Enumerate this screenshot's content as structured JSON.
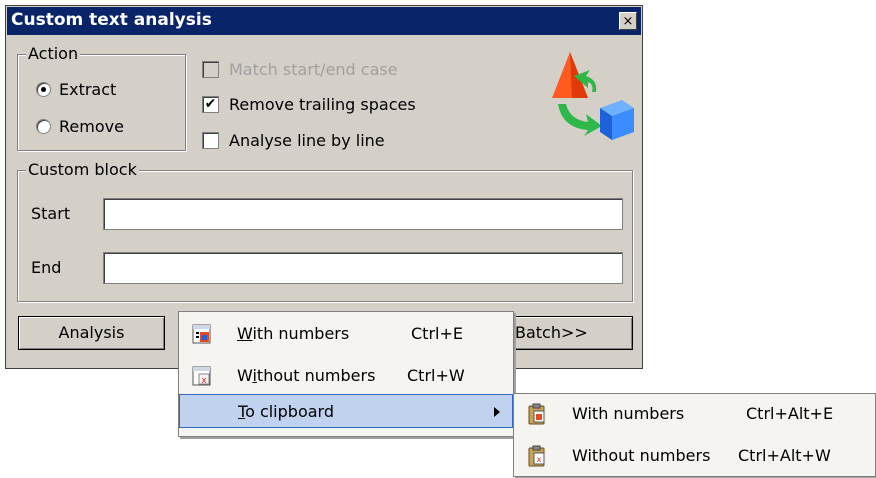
{
  "window": {
    "title": "Custom text analysis",
    "close_glyph": "×"
  },
  "action": {
    "legend": "Action",
    "options": [
      {
        "label": "Extract",
        "selected": true
      },
      {
        "label": "Remove",
        "selected": false
      }
    ]
  },
  "options": [
    {
      "label": "Match start/end case",
      "checked": false,
      "disabled": true
    },
    {
      "label": "Remove trailing spaces",
      "checked": true,
      "disabled": false
    },
    {
      "label": "Analyse line by line",
      "checked": false,
      "disabled": false
    }
  ],
  "custom_block": {
    "legend": "Custom block",
    "start_label": "Start",
    "start_value": "",
    "end_label": "End",
    "end_value": ""
  },
  "buttons": {
    "analysis": "Analysis",
    "batch": "Batch>>"
  },
  "menu": {
    "items": [
      {
        "prefix": "",
        "underline": "W",
        "rest": "ith numbers",
        "shortcut": "Ctrl+E",
        "icon": "table-numbers-icon"
      },
      {
        "prefix": "W",
        "underline": "i",
        "rest": "thout numbers",
        "shortcut": "Ctrl+W",
        "icon": "table-no-numbers-icon"
      },
      {
        "prefix": "",
        "underline": "T",
        "rest": "o clipboard",
        "shortcut": "",
        "icon": "",
        "submenu": true,
        "highlighted": true
      }
    ]
  },
  "submenu": {
    "items": [
      {
        "label": "With numbers",
        "shortcut": "Ctrl+Alt+E",
        "icon": "clipboard-numbers-icon"
      },
      {
        "label": "Without numbers",
        "shortcut": "Ctrl+Alt+W",
        "icon": "clipboard-no-numbers-icon"
      }
    ]
  },
  "colors": {
    "titlebar": "#0a246a",
    "highlight": "#c1d2ee",
    "face": "#d4d0c8"
  }
}
